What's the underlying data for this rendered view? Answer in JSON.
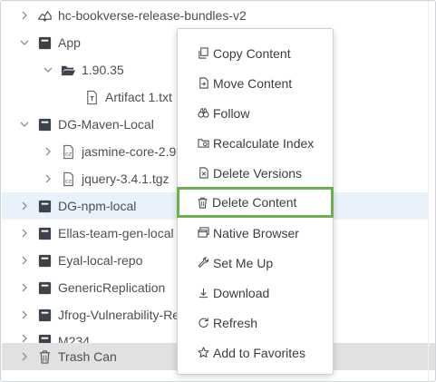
{
  "tree": {
    "rows": [
      {
        "label": "hc-bookverse-release-bundles-v2",
        "icon": "release-bundle-icon",
        "chevron": "right"
      },
      {
        "label": "App",
        "icon": "repository-icon",
        "chevron": "down"
      },
      {
        "label": "1.90.35",
        "icon": "folder-open-icon",
        "chevron": "down"
      },
      {
        "label": "Artifact 1.txt",
        "icon": "text-file-icon",
        "chevron": ""
      },
      {
        "label": "DG-Maven-Local",
        "icon": "repository-icon",
        "chevron": "down"
      },
      {
        "label": "jasmine-core-2.9",
        "icon": "archive-file-icon",
        "chevron": "right"
      },
      {
        "label": "jquery-3.4.1.tgz",
        "icon": "archive-file-icon",
        "chevron": "right"
      },
      {
        "label": "DG-npm-local",
        "icon": "repository-icon",
        "chevron": "right"
      },
      {
        "label": "Ellas-team-gen-local",
        "icon": "repository-icon",
        "chevron": "right"
      },
      {
        "label": "Eyal-local-repo",
        "icon": "repository-icon",
        "chevron": "right"
      },
      {
        "label": "GenericReplication",
        "icon": "repository-icon",
        "chevron": "right"
      },
      {
        "label": "Jfrog-Vulnerability-Re",
        "icon": "repository-icon",
        "chevron": "right"
      },
      {
        "label": "M234",
        "icon": "repository-icon",
        "chevron": "right"
      },
      {
        "label": "Trash Can",
        "icon": "trash-icon",
        "chevron": "right"
      }
    ]
  },
  "context_menu": {
    "items": [
      {
        "label": "Copy Content",
        "icon": "copy-icon"
      },
      {
        "label": "Move Content",
        "icon": "move-icon"
      },
      {
        "label": "Follow",
        "icon": "binoculars-icon"
      },
      {
        "label": "Recalculate Index",
        "icon": "recalculate-icon"
      },
      {
        "label": "Delete Versions",
        "icon": "delete-versions-icon"
      },
      {
        "label": "Delete Content",
        "icon": "trash-icon"
      },
      {
        "label": "Native Browser",
        "icon": "browser-icon"
      },
      {
        "label": "Set Me Up",
        "icon": "wrench-icon"
      },
      {
        "label": "Download",
        "icon": "download-icon"
      },
      {
        "label": "Refresh",
        "icon": "refresh-icon"
      },
      {
        "label": "Add to Favorites",
        "icon": "star-icon"
      }
    ]
  },
  "colors": {
    "highlight_border": "#6ab04c",
    "selected_row": "#e9f1fb",
    "trash_row": "#e1e1e1"
  }
}
